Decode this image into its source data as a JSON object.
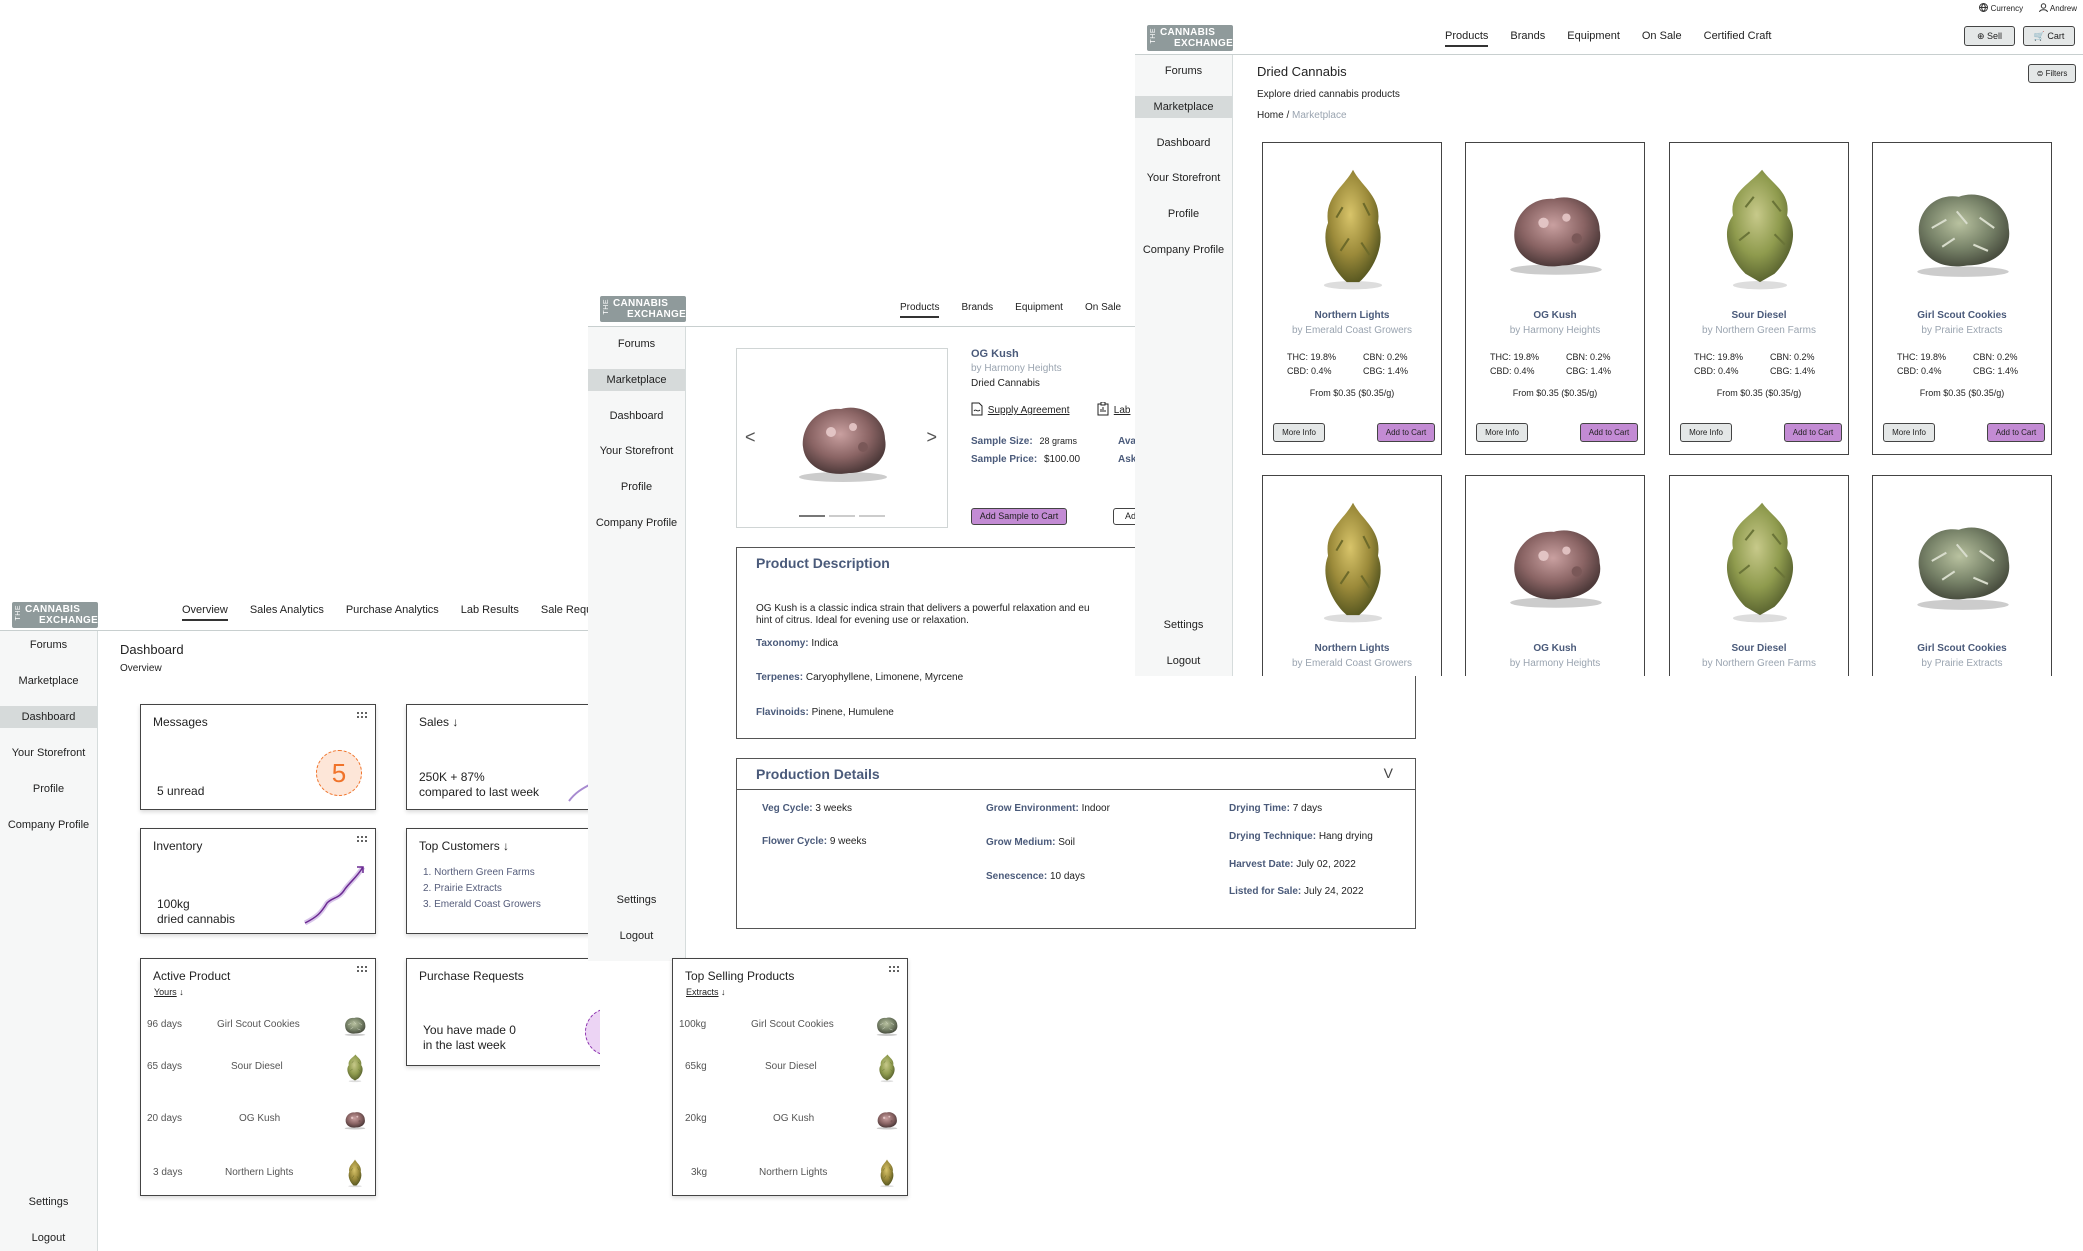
{
  "brand": {
    "line1": "CANNABIS",
    "line2": "EXCHANGE",
    "prefix": "THE"
  },
  "colors": {
    "accent_purple": "#c38bd4",
    "orange": "#f0732a",
    "purple": "#8a2fae",
    "sidebar_active": "#d6dada"
  },
  "sidebar": {
    "items": [
      "Forums",
      "Marketplace",
      "Dashboard",
      "Your Storefront",
      "Profile",
      "Company Profile"
    ],
    "settings": "Settings",
    "logout": "Logout"
  },
  "dashboard": {
    "tabs": [
      "Overview",
      "Sales Analytics",
      "Purchase Analytics",
      "Lab Results",
      "Sale Request"
    ],
    "title": "Dashboard",
    "subtitle": "Overview",
    "messages": {
      "title": "Messages",
      "count": "5",
      "text": "5 unread"
    },
    "sales": {
      "title": "Sales",
      "arrow": "↓",
      "line1": "250K + 87%",
      "line2": "compared to last week"
    },
    "inventory": {
      "title": "Inventory",
      "line1": "100kg",
      "line2": "dried cannabis"
    },
    "top_customers": {
      "title": "Top Customers",
      "arrow": "↓",
      "items": [
        "1. Northern Green Farms",
        "2. Prairie Extracts",
        "3. Emerald Coast Growers"
      ]
    },
    "active_product": {
      "title": "Active Product",
      "filter": "Yours",
      "arrow": "↓",
      "rows": [
        {
          "age": "96 days",
          "name": "Girl Scout Cookies",
          "icon": "gsc-bud-icon"
        },
        {
          "age": "65 days",
          "name": "Sour Diesel",
          "icon": "sd-bud-icon"
        },
        {
          "age": "20 days",
          "name": "OG Kush",
          "icon": "og-bud-icon"
        },
        {
          "age": "3 days",
          "name": "Northern Lights",
          "icon": "nl-bud-icon"
        }
      ]
    },
    "purchase_requests": {
      "title": "Purchase Requests",
      "count": "0",
      "line1": "You have made 0",
      "line2": "in the last week"
    },
    "top_selling": {
      "title": "Top Selling Products",
      "filter": "Extracts",
      "arrow": "↓",
      "rows": [
        {
          "qty": "100kg",
          "name": "Girl Scout Cookies"
        },
        {
          "qty": "65kg",
          "name": "Sour Diesel"
        },
        {
          "qty": "20kg",
          "name": "OG Kush"
        },
        {
          "qty": "3kg",
          "name": "Northern Lights"
        }
      ]
    }
  },
  "product": {
    "nav": [
      "Products",
      "Brands",
      "Equipment",
      "On Sale"
    ],
    "name": "OG Kush",
    "by": "by Harmony Heights",
    "category": "Dried Cannabis",
    "supply_agreement": "Supply Agreement",
    "lab": "Lab",
    "sample_size_label": "Sample Size:",
    "sample_size": "28 grams",
    "sample_price_label": "Sample Price:",
    "sample_price": "$100.00",
    "ava_label": "Ava",
    "ask_label": "Ask",
    "add_sample": "Add Sample to Cart",
    "add_partial": "Add",
    "prev": "<",
    "next": ">",
    "description_title": "Product Description",
    "description_line1": "OG Kush is a classic indica strain that delivers a powerful relaxation  and eu",
    "description_line2": "hint of citrus. Ideal for evening use or relaxation.",
    "taxonomy_label": "Taxonomy:",
    "taxonomy": "Indica",
    "terpenes_label": "Terpenes:",
    "terpenes": "Caryophyllene, Limonene, Myrcene",
    "flavinoids_label": "Flavinoids:",
    "flavinoids": "Pinene, Humulene",
    "production_title": "Production Details",
    "production_toggle": "V",
    "details": {
      "veg_label": "Veg Cycle:",
      "veg": "3 weeks",
      "flower_label": "Flower Cycle:",
      "flower": "9 weeks",
      "env_label": "Grow Environment:",
      "env": "Indoor",
      "medium_label": "Grow Medium:",
      "medium": "Soil",
      "sen_label": "Senescence:",
      "sen": "10 days",
      "dry_time_label": "Drying Time:",
      "dry_time": "7 days",
      "dry_tech_label": "Drying Technique:",
      "dry_tech": "Hang drying",
      "harvest_label": "Harvest Date:",
      "harvest": "July 02, 2022",
      "listed_label": "Listed for Sale:",
      "listed": "July 24, 2022"
    }
  },
  "market": {
    "utility": {
      "currency": "Currency",
      "user": "Andrew"
    },
    "nav": [
      "Products",
      "Brands",
      "Equipment",
      "On Sale",
      "Certified Craft"
    ],
    "sell": "Sell",
    "cart": "Cart",
    "title": "Dried Cannabis",
    "subtitle": "Explore dried cannabis products",
    "breadcrumb_home": "Home",
    "breadcrumb_sep": "/",
    "breadcrumb_current": "Marketplace",
    "filters": "Filters",
    "more_info": "More Info",
    "add_to_cart": "Add to Cart",
    "products": [
      {
        "name": "Northern Lights",
        "by": "by Emerald Coast Growers",
        "thc": "THC: 19.8%",
        "cbn": "CBN: 0.2%",
        "cbd": "CBD: 0.4%",
        "cbg": "CBG: 1.4%",
        "price": "From $0.35 ($0.35/g)",
        "icon": "nl-bud-icon"
      },
      {
        "name": "OG Kush",
        "by": "by Harmony Heights",
        "thc": "THC: 19.8%",
        "cbn": "CBN: 0.2%",
        "cbd": "CBD: 0.4%",
        "cbg": "CBG: 1.4%",
        "price": "From $0.35 ($0.35/g)",
        "icon": "og-bud-icon"
      },
      {
        "name": "Sour Diesel",
        "by": "by Northern Green Farms",
        "thc": "THC: 19.8%",
        "cbn": "CBN: 0.2%",
        "cbd": "CBD: 0.4%",
        "cbg": "CBG: 1.4%",
        "price": "From $0.35 ($0.35/g)",
        "icon": "sd-bud-icon"
      },
      {
        "name": "Girl Scout Cookies",
        "by": "by Prairie Extracts",
        "thc": "THC: 19.8%",
        "cbn": "CBN: 0.2%",
        "cbd": "CBD: 0.4%",
        "cbg": "CBG: 1.4%",
        "price": "From $0.35 ($0.35/g)",
        "icon": "gsc-bud-icon"
      },
      {
        "name": "Northern Lights",
        "by": "by Emerald Coast Growers",
        "icon": "nl-bud-icon"
      },
      {
        "name": "OG Kush",
        "by": "by Harmony Heights",
        "icon": "og-bud-icon"
      },
      {
        "name": "Sour Diesel",
        "by": "by Northern Green Farms",
        "icon": "sd-bud-icon"
      },
      {
        "name": "Girl Scout Cookies",
        "by": "by Prairie Extracts",
        "icon": "gsc-bud-icon"
      }
    ]
  }
}
